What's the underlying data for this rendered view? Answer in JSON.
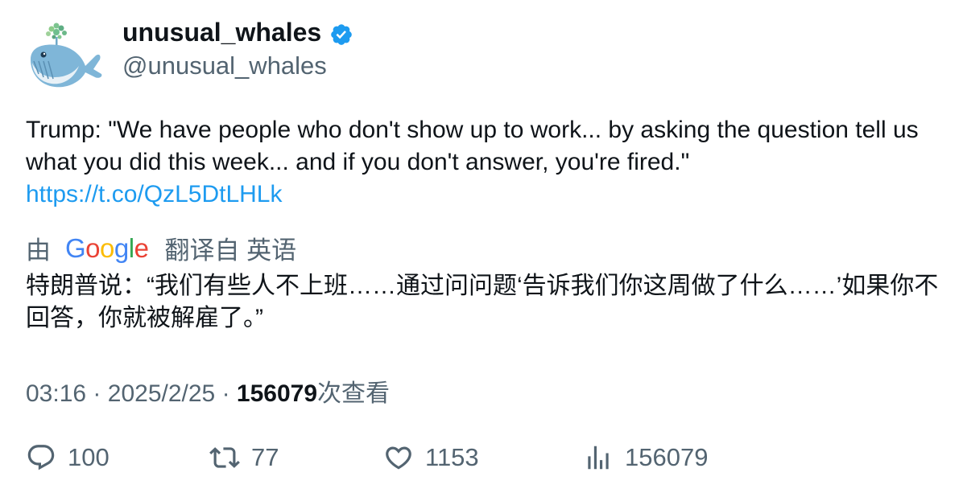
{
  "author": {
    "display_name": "unusual_whales",
    "handle": "@unusual_whales",
    "verified_icon": "verified-badge-icon",
    "avatar_icon": "whale-avatar"
  },
  "tweet": {
    "text": "Trump: \"We have people who don't show up to work... by asking the question tell us what you did this week... and if you don't answer, you're fired.\"",
    "link": "https://t.co/QzL5DtLHLk"
  },
  "translation": {
    "by_label": "由",
    "provider": [
      "G",
      "o",
      "o",
      "g",
      "l",
      "e"
    ],
    "from_label": "翻译自 英语",
    "text": "特朗普说：“我们有些人不上班……通过问问题‘告诉我们你这周做了什么……’如果你不回答，你就被解雇了。”"
  },
  "meta": {
    "time": "03:16",
    "date": "2025/2/25",
    "separator": "·",
    "views": "156079",
    "views_label": "次查看"
  },
  "actions": {
    "replies": "100",
    "retweets": "77",
    "likes": "1153",
    "views": "156079"
  },
  "colors": {
    "text": "#0f1419",
    "secondary": "#536471",
    "link": "#1d9bf0",
    "verified": "#1d9bf0"
  }
}
